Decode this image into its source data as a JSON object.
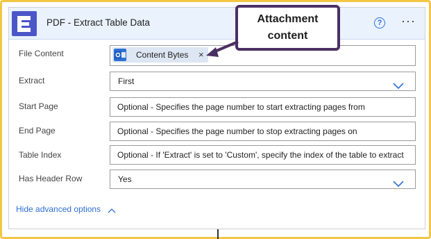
{
  "card": {
    "title": "PDF - Extract Table Data",
    "logo_icon": "encodian-logo-icon",
    "help_icon": "?",
    "more_icon": "···"
  },
  "fields": [
    {
      "label": "File Content",
      "token": "Content Bytes",
      "token_close": "×",
      "token_icon": "outlook-icon"
    },
    {
      "label": "Extract",
      "value": "First",
      "type": "dropdown"
    },
    {
      "label": "Start Page",
      "value": "Optional - Specifies the page number to start extracting pages from"
    },
    {
      "label": "End Page",
      "value": "Optional - Specifies the page number to stop extracting pages on"
    },
    {
      "label": "Table Index",
      "value": "Optional - If 'Extract' is set to 'Custom', specify the index of the table to extract"
    },
    {
      "label": "Has Header Row",
      "value": "Yes",
      "type": "dropdown"
    }
  ],
  "advanced": {
    "label": "Hide advanced options"
  },
  "annotation": {
    "line1": "Attachment",
    "line2": "content"
  },
  "colors": {
    "accent": "#2f6fd6",
    "frame": "#f2c744",
    "callout_border": "#4a2f63",
    "header_bg": "#eaf2fd",
    "logo_bg": "#4b57c8"
  }
}
